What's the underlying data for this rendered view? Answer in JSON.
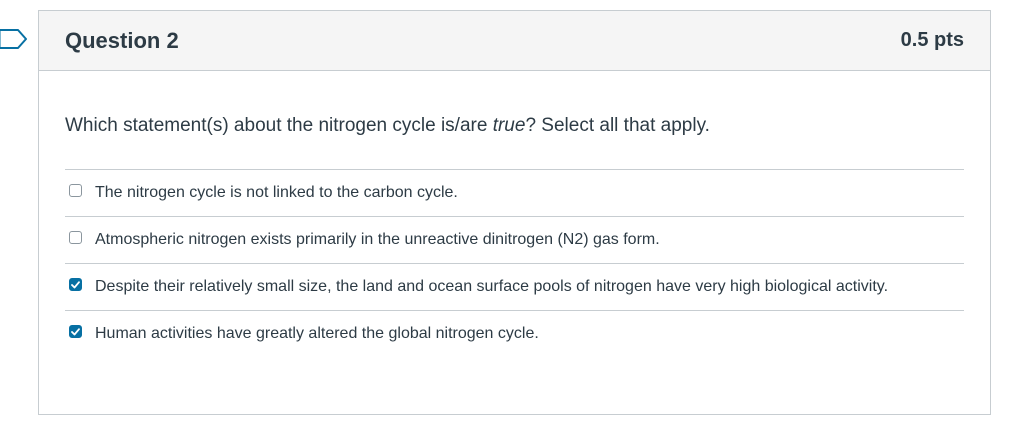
{
  "question": {
    "title": "Question 2",
    "points": "0.5 pts",
    "text_before": "Which statement(s) about the nitrogen cycle is/are ",
    "text_emphasis": "true",
    "text_after": "? Select all that apply."
  },
  "answers": [
    {
      "label": "The nitrogen cycle is not linked to the carbon cycle.",
      "checked": false
    },
    {
      "label": "Atmospheric nitrogen exists primarily in the unreactive dinitrogen (N2) gas form.",
      "checked": false
    },
    {
      "label": "Despite their relatively small size, the land and ocean surface pools of nitrogen have very high biological activity.",
      "checked": true
    },
    {
      "label": "Human activities have greatly altered the global nitrogen cycle.",
      "checked": true
    }
  ],
  "colors": {
    "accent": "#0770a3",
    "border": "#c7cdd1",
    "header_bg": "#f5f5f5",
    "text": "#2d3b45"
  },
  "icons": {
    "flag": "flag-icon",
    "check": "checkmark-icon"
  }
}
